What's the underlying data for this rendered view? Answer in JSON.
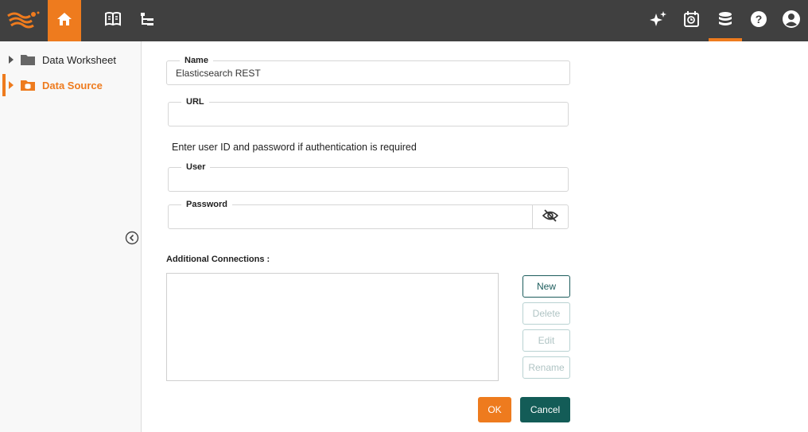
{
  "topbar": {
    "icons": [
      "logo-icon",
      "home-icon",
      "book-icon",
      "tree-icon",
      "sparkle-icon",
      "scheduler-icon",
      "database-icon",
      "help-icon",
      "account-icon"
    ],
    "accent": "#ee7b1e",
    "background": "#404040"
  },
  "sidebar": {
    "items": [
      {
        "label": "Data Worksheet",
        "icon": "folder-icon"
      },
      {
        "label": "Data Source",
        "icon": "datasource-icon",
        "selected": true
      }
    ],
    "collapse_icon": "chevron-left-icon"
  },
  "form": {
    "name_label": "Name",
    "name_value": "Elasticsearch REST",
    "url_label": "URL",
    "url_value": "",
    "auth_info": "Enter user ID and password if authentication is required",
    "user_label": "User",
    "user_value": "",
    "password_label": "Password",
    "password_value": "",
    "eye_icon": "eye-off-icon",
    "additional_label": "Additional Connections :",
    "buttons": {
      "new": "New",
      "delete": "Delete",
      "edit": "Edit",
      "rename": "Rename"
    },
    "ok": "OK",
    "cancel": "Cancel"
  }
}
